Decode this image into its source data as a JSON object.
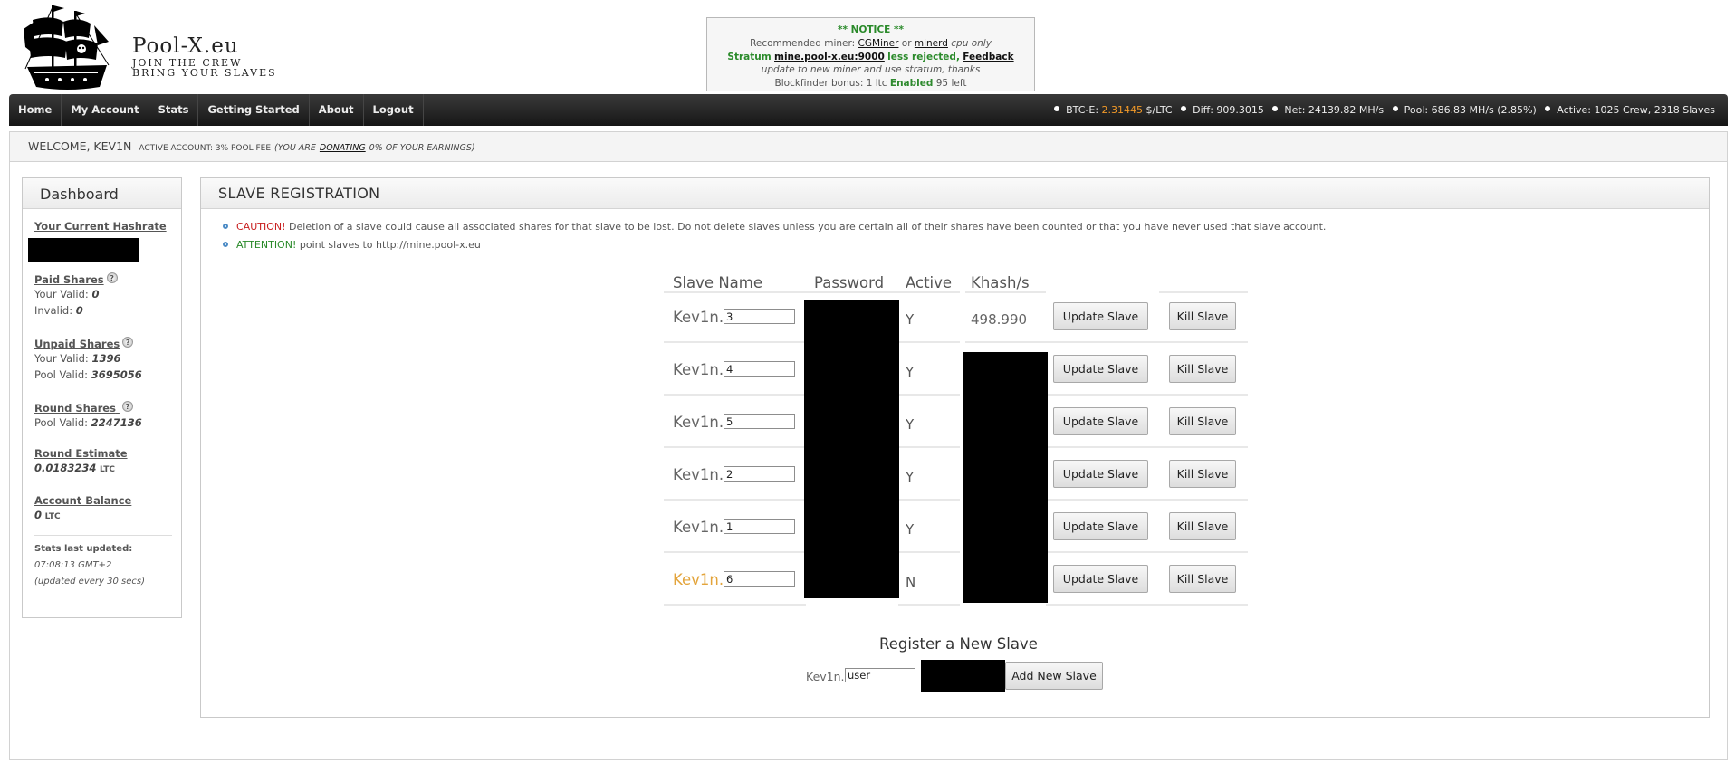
{
  "logo": {
    "title": "Pool-X.eu",
    "line1": "Join the Crew",
    "line2": "Bring your Slaves"
  },
  "notice": {
    "heading": "** NOTICE **",
    "recommended_prefix": "Recommended miner:",
    "miner1": "CGMiner",
    "or": "or",
    "miner2": "minerd",
    "cpu_only": "cpu only",
    "stratum_label": "Stratum",
    "stratum_url": "mine.pool-x.eu:9000",
    "less_rejected": "less rejected,",
    "feedback": "Feedback",
    "update_line": "update to new miner and use stratum, thanks",
    "blockfinder_prefix": "Blockfinder bonus: 1 ltc",
    "enabled": "Enabled",
    "left": "95 left"
  },
  "nav": {
    "links": [
      "Home",
      "My Account",
      "Stats",
      "Getting Started",
      "About",
      "Logout"
    ],
    "btc_label": "BTC-E:",
    "btc_value": "2.31445",
    "btc_unit": "$/LTC",
    "diff": "Diff: 909.3015",
    "net": "Net: 24139.82 MH/s",
    "pool": "Pool: 686.83 MH/s (2.85%)",
    "active": "Active: 1025 Crew, 2318 Slaves"
  },
  "welcome": {
    "greeting": "WELCOME, KEV1N",
    "account": "active account: 3% pool fee",
    "donating_prefix": "(You are",
    "donating": "donating",
    "donating_suffix": "0% of your earnings)"
  },
  "sidebar": {
    "title": "Dashboard",
    "hashrate_title": "Your Current Hashrate",
    "paid_title": "Paid Shares",
    "paid_valid_label": "Your Valid:",
    "paid_valid": "0",
    "paid_invalid_label": "Invalid:",
    "paid_invalid": "0",
    "unpaid_title": "Unpaid Shares",
    "unpaid_valid_label": "Your Valid:",
    "unpaid_valid": "1396",
    "unpaid_pool_label": "Pool Valid:",
    "unpaid_pool": "3695056",
    "round_title": "Round Shares",
    "round_pool_label": "Pool Valid:",
    "round_pool": "2247136",
    "estimate_title": "Round Estimate",
    "estimate_value": "0.0183234",
    "estimate_unit": "LTC",
    "balance_title": "Account Balance",
    "balance_value": "0",
    "balance_unit": "LTC",
    "stats_updated_label": "Stats last updated:",
    "stats_time": "07:08:13 GMT+2",
    "stats_interval": "(updated every 30 secs)"
  },
  "main": {
    "title": "Slave Registration",
    "caution_label": "CAUTION!",
    "caution_text": "Deletion of a slave could cause all associated shares for that slave to be lost. Do not delete slaves unless you are certain all of their shares have been counted or that you have never used that slave account.",
    "attention_label": "ATTENTION!",
    "attention_text": "point slaves to http://mine.pool-x.eu"
  },
  "table": {
    "headers": {
      "name": "Slave Name",
      "password": "Password",
      "active": "Active",
      "khash": "Khash/s"
    },
    "update_label": "Update Slave",
    "kill_label": "Kill Slave",
    "rows": [
      {
        "prefix": "Kev1n.",
        "suffix": "3",
        "active": "Y",
        "khash": "498.990",
        "highlight": false
      },
      {
        "prefix": "Kev1n.",
        "suffix": "4",
        "active": "Y",
        "khash": "",
        "highlight": false
      },
      {
        "prefix": "Kev1n.",
        "suffix": "5",
        "active": "Y",
        "khash": "",
        "highlight": false
      },
      {
        "prefix": "Kev1n.",
        "suffix": "2",
        "active": "Y",
        "khash": "",
        "highlight": false
      },
      {
        "prefix": "Kev1n.",
        "suffix": "1",
        "active": "Y",
        "khash": "",
        "highlight": false
      },
      {
        "prefix": "Kev1n.",
        "suffix": "6",
        "active": "N",
        "khash": "",
        "highlight": true
      }
    ]
  },
  "register": {
    "title": "Register a New Slave",
    "prefix": "Kev1n.",
    "input_value": "user",
    "button": "Add New Slave"
  },
  "colors": {
    "nav_bg": "#1e1e1e",
    "btc_highlight": "#f19928",
    "caution": "#c82020",
    "attention": "#2a8a2a",
    "inactive_slave": "#e3a43b"
  }
}
